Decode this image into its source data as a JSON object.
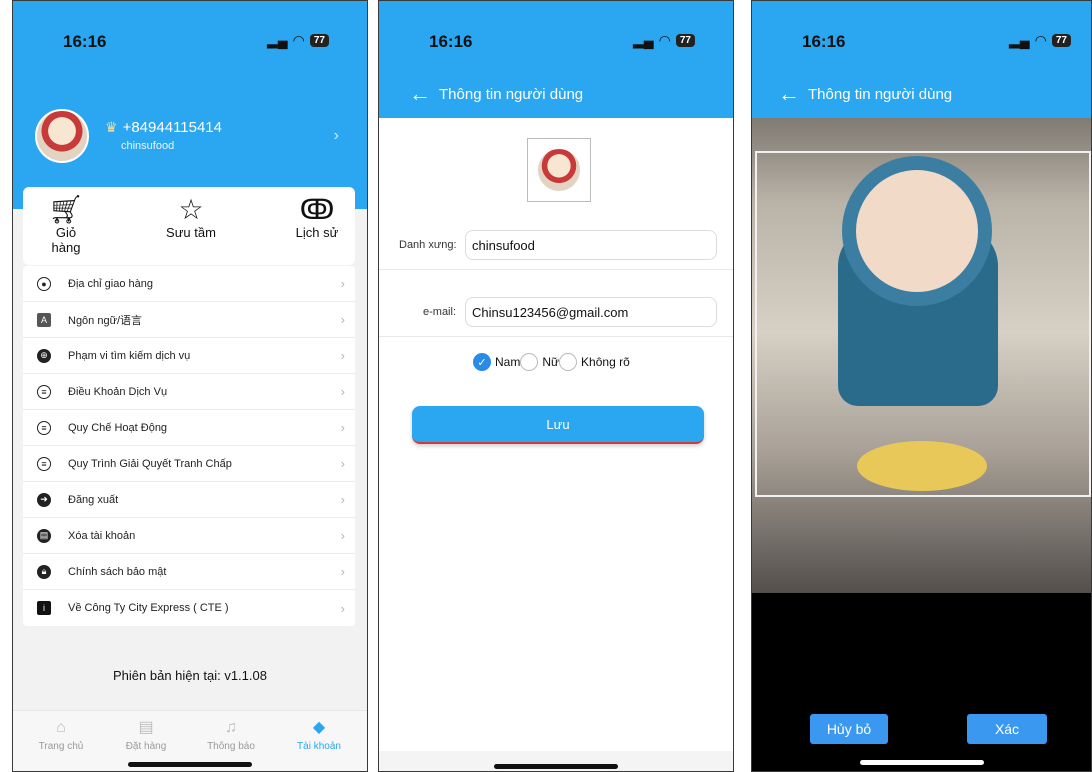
{
  "screen1": {
    "status": {
      "time": "16:16",
      "signal": "::",
      "wifi": "≋",
      "battery": "77"
    },
    "profile": {
      "phone": "+84944115414",
      "username": "chinsufood"
    },
    "quick_actions": [
      {
        "label": "Giỏ hàng",
        "icon": "cart-icon"
      },
      {
        "label": "Sưu tầm",
        "icon": "star-icon"
      },
      {
        "label": "Lịch sử",
        "icon": "footprint-icon"
      }
    ],
    "menu": [
      {
        "label": "Địa chỉ giao hàng",
        "icon": "location-pin-icon"
      },
      {
        "label": "Ngôn ngữ/语言",
        "icon": "language-icon"
      },
      {
        "label": "Phạm vi tìm kiếm dịch vụ",
        "icon": "globe-icon"
      },
      {
        "label": "Điều Khoản Dịch Vụ",
        "icon": "list-icon"
      },
      {
        "label": "Quy Chế Hoạt Động",
        "icon": "list-icon"
      },
      {
        "label": "Quy Trình Giải Quyết Tranh Chấp",
        "icon": "list-icon"
      },
      {
        "label": "Đăng xuất",
        "icon": "logout-icon"
      },
      {
        "label": "Xóa tài khoản",
        "icon": "delete-account-icon"
      },
      {
        "label": "Chính sách bảo mật",
        "icon": "lock-icon"
      },
      {
        "label": "Về Công Ty City Express ( CTE )",
        "icon": "info-icon"
      }
    ],
    "version": "Phiên bản hiện tại: v1.1.08",
    "tabs": [
      {
        "label": "Trang chủ",
        "icon": "home-icon"
      },
      {
        "label": "Đặt hàng",
        "icon": "order-icon"
      },
      {
        "label": "Thông báo",
        "icon": "bell-icon"
      },
      {
        "label": "Tài khoản",
        "icon": "diamond-icon"
      }
    ],
    "colors": {
      "accent": "#2ba6f0"
    }
  },
  "screen2": {
    "status": {
      "time": "16:16",
      "battery": "77"
    },
    "title": "Thông tin người dùng",
    "name_label": "Danh xưng:",
    "name_value": "chinsufood",
    "email_label": "e-mail:",
    "email_value": "Chinsu123456@gmail.com",
    "gender_options": [
      "Nam",
      "Nữ",
      "Không rõ"
    ],
    "gender_selected": "Nam",
    "save_label": "Lưu"
  },
  "screen3": {
    "status": {
      "time": "16:16",
      "battery": "77"
    },
    "title": "Thông tin người dùng",
    "cancel_label": "Hủy bỏ",
    "confirm_label": "Xác"
  }
}
